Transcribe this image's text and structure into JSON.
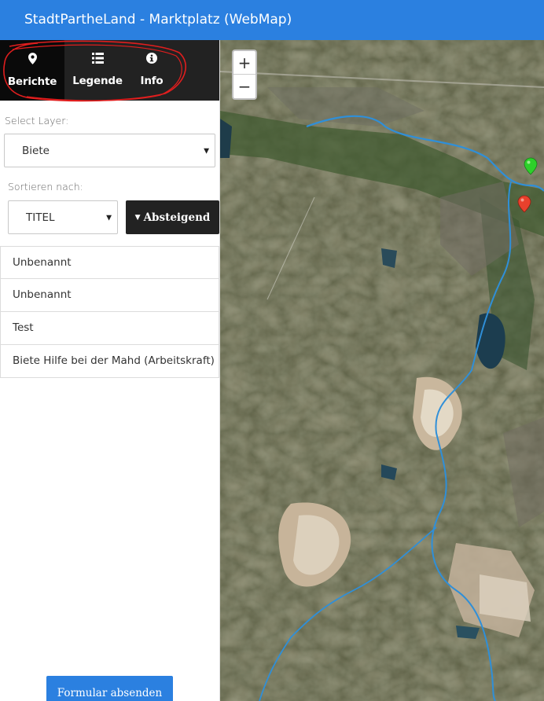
{
  "app": {
    "title": "StadtPartheLand - Marktplatz (WebMap)"
  },
  "tabs": [
    {
      "label": "Berichte",
      "icon": "map-marker-icon",
      "active": true
    },
    {
      "label": "Legende",
      "icon": "list-icon",
      "active": false
    },
    {
      "label": "Info",
      "icon": "info-icon",
      "active": false
    }
  ],
  "layer": {
    "label": "Select Layer:",
    "value": "Biete"
  },
  "sort": {
    "label": "Sortieren nach:",
    "value": "TITEL",
    "order_label": "Absteigend"
  },
  "list": {
    "items": [
      "Unbenannt",
      "Unbenannt",
      "Test",
      "Biete Hilfe bei der Mahd (Arbeitskraft)"
    ]
  },
  "submit": {
    "label": "Formular absenden"
  },
  "map": {
    "zoom_in": "+",
    "zoom_out": "−",
    "markers": [
      {
        "color": "#2dd12a"
      },
      {
        "color": "#e8412c"
      }
    ]
  },
  "colors": {
    "navbar": "#2b80e0",
    "tabbar": "#222222",
    "annotation": "#e01e1e",
    "river": "#2f8fd8"
  }
}
